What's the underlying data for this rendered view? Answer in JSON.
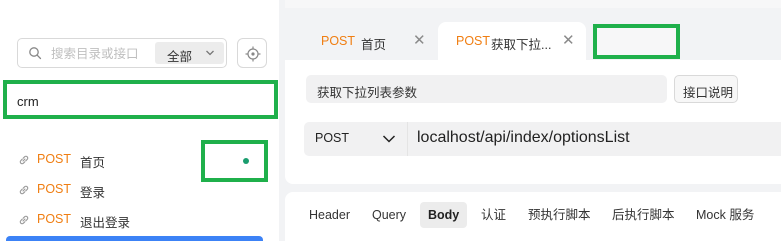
{
  "sidebar": {
    "search": {
      "placeholder": "搜索目录或接口"
    },
    "scope": {
      "label": "全部"
    },
    "folder": {
      "label": "crm"
    },
    "items": [
      {
        "method": "POST",
        "name": "首页"
      },
      {
        "method": "POST",
        "name": "登录"
      },
      {
        "method": "POST",
        "name": "退出登录"
      }
    ]
  },
  "tabs": [
    {
      "method": "POST",
      "title": "首页",
      "close": "✕"
    },
    {
      "method": "POST",
      "title": "获取下拉...",
      "close": "✕"
    }
  ],
  "request": {
    "name": "获取下拉列表参数",
    "doc_button": "接口说明",
    "method": "POST",
    "url": "localhost/api/index/optionsList"
  },
  "request_tabs": [
    "Header",
    "Query",
    "Body",
    "认证",
    "预执行脚本",
    "后执行脚本",
    "Mock 服务"
  ],
  "colors": {
    "method_post": "#f07e12",
    "highlight_green": "#1fb04b",
    "status_dot": "#1a9d6e",
    "selected_blue": "#3c82f6"
  },
  "icons": {
    "search": "search-icon",
    "chevron": "chevron-down-icon",
    "locate": "locate-icon",
    "link": "link-icon",
    "close": "close-icon"
  }
}
